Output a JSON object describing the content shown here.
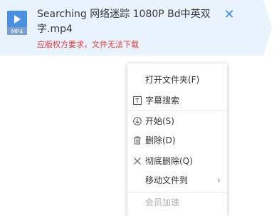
{
  "download_item": {
    "file_type": "MP4",
    "file_name": "Searching 网络迷踪 1080P Bd中英双字.mp4",
    "warning": "应版权方要求，文件无法下载",
    "close_icon": "close-icon"
  },
  "context_menu": {
    "open_folder": "打开文件夹(F)",
    "subtitle_search": "字幕搜索",
    "start": "开始(S)",
    "delete": "删除(D)",
    "delete_permanent": "彻底删除(Q)",
    "move_file_to": "移动文件到",
    "member_accelerate": "会员加速"
  },
  "colors": {
    "accent": "#3a8ce8",
    "warning": "#e03c3c",
    "row_bg": "#e9f3fe"
  }
}
